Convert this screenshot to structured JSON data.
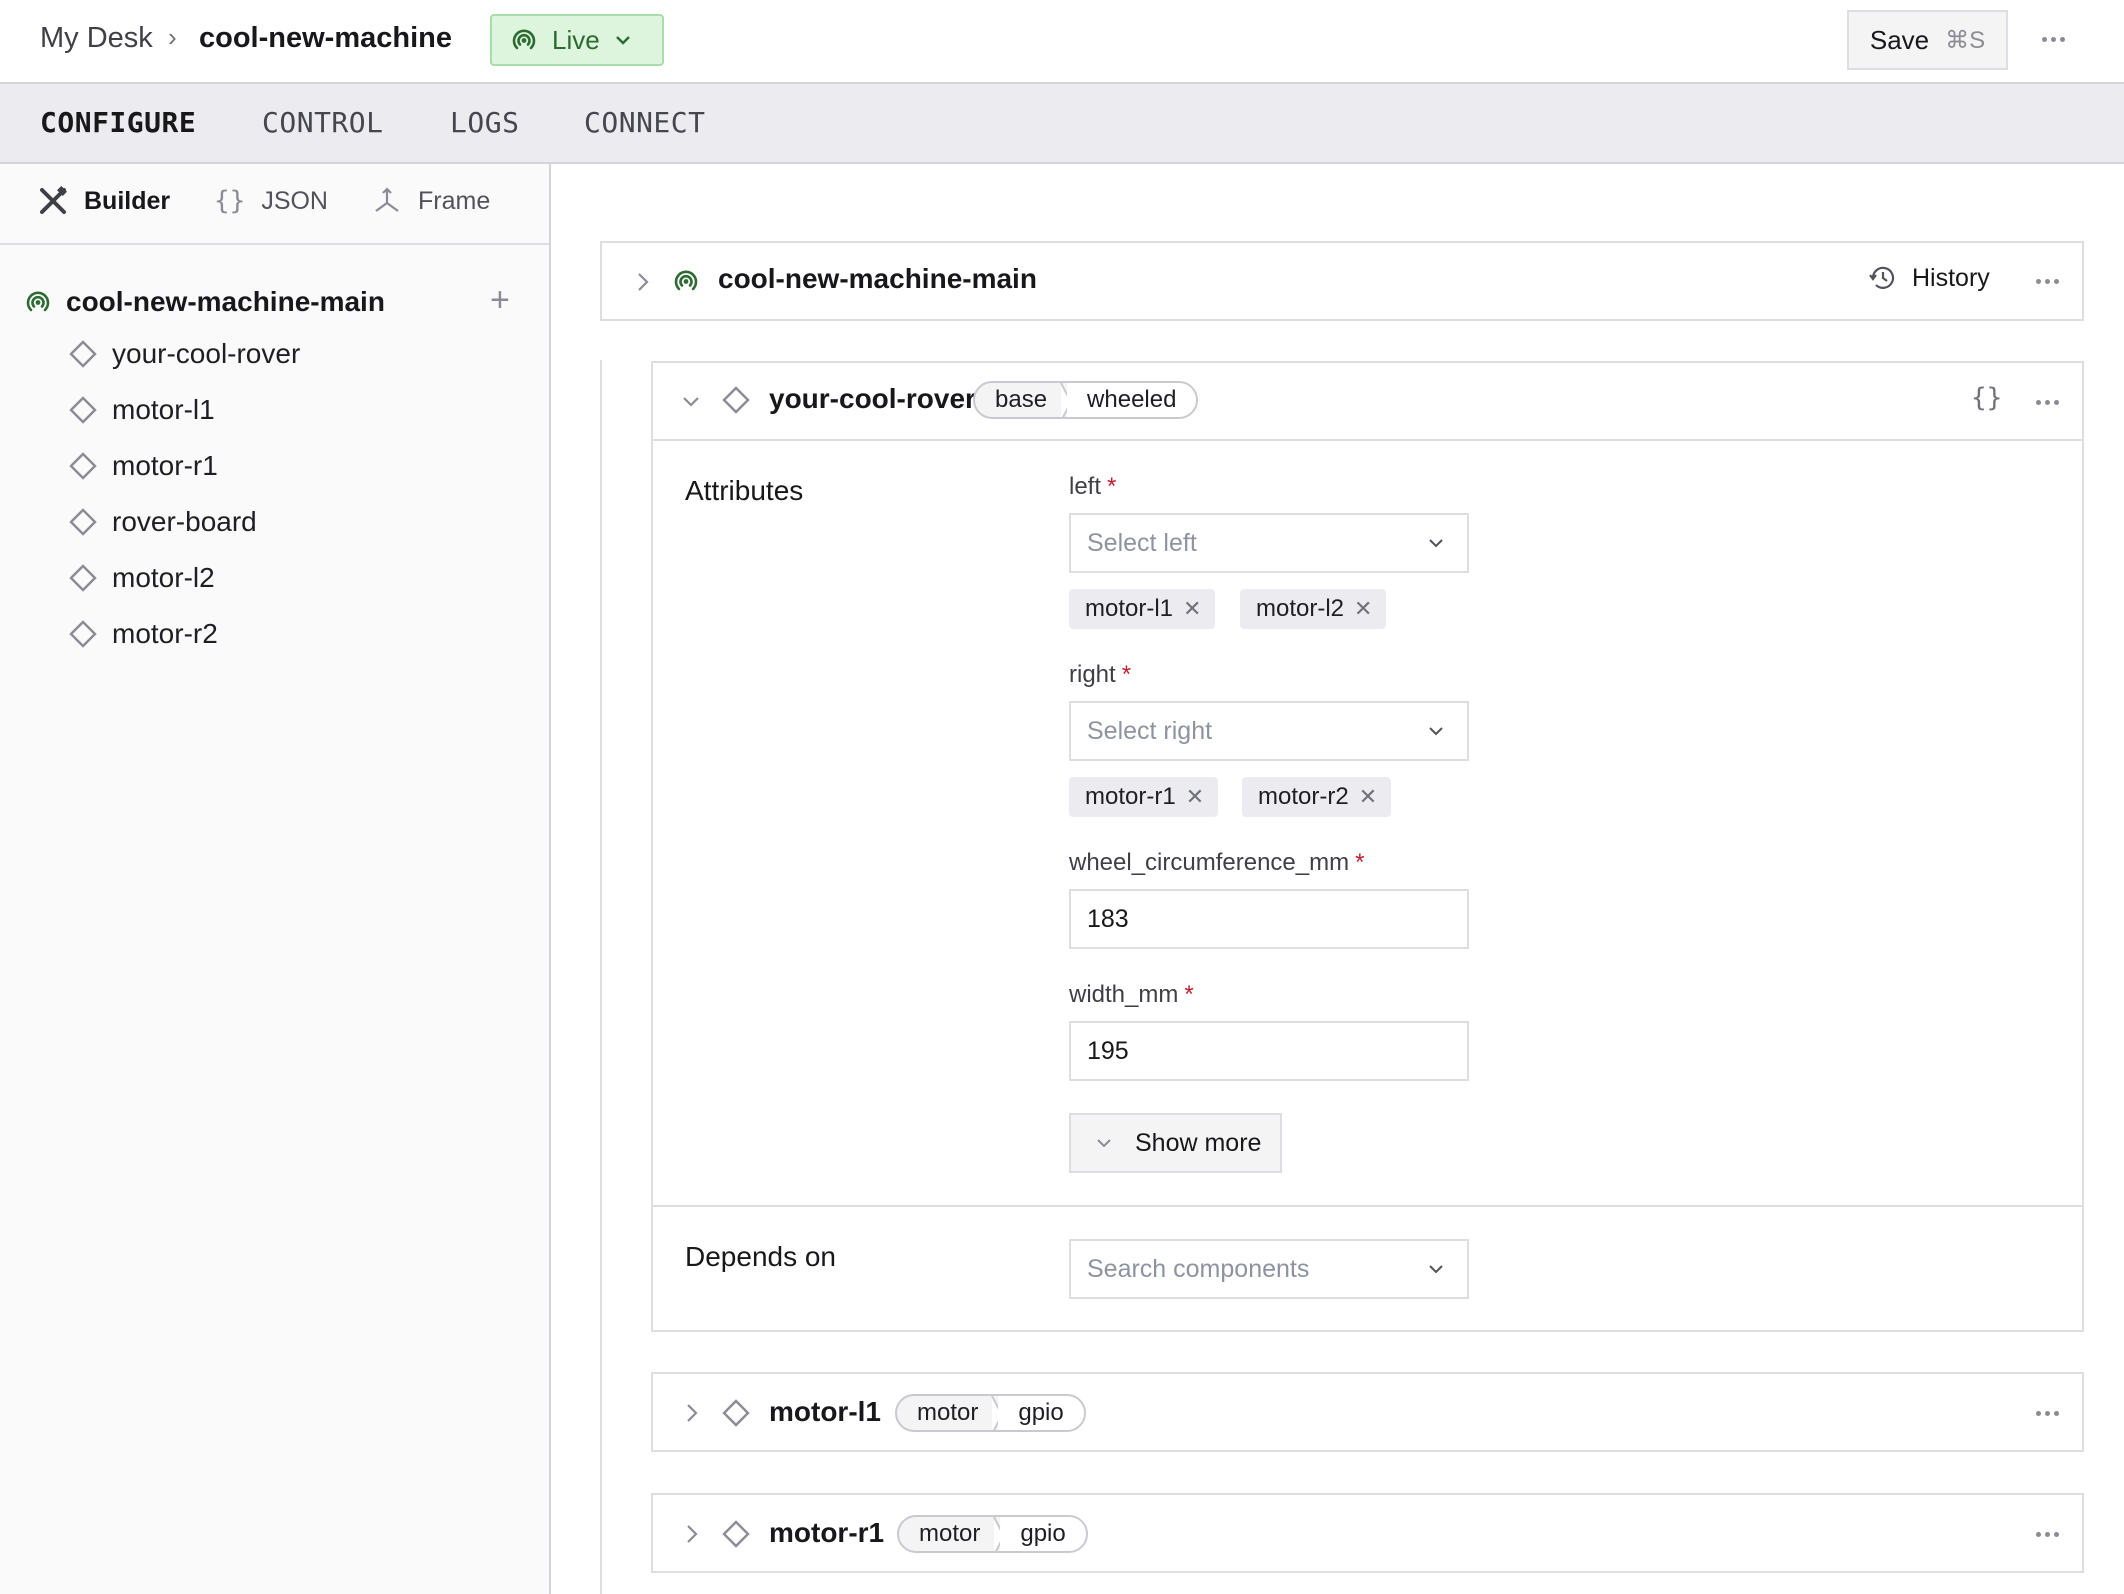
{
  "header": {
    "breadcrumb_root": "My Desk",
    "breadcrumb_separator": "›",
    "breadcrumb_current": "cool-new-machine",
    "status_label": "Live",
    "save_label": "Save",
    "save_shortcut": "⌘S"
  },
  "tabs": [
    {
      "label": "CONFIGURE",
      "active": true
    },
    {
      "label": "CONTROL",
      "active": false
    },
    {
      "label": "LOGS",
      "active": false
    },
    {
      "label": "CONNECT",
      "active": false
    }
  ],
  "sidebar": {
    "subtabs": [
      {
        "label": "Builder",
        "icon": "tools-icon",
        "active": true
      },
      {
        "label": "JSON",
        "icon": "braces-icon",
        "active": false
      },
      {
        "label": "Frame",
        "icon": "axes-icon",
        "active": false
      }
    ],
    "root": "cool-new-machine-main",
    "items": [
      "your-cool-rover",
      "motor-l1",
      "motor-r1",
      "rover-board",
      "motor-l2",
      "motor-r2"
    ]
  },
  "main": {
    "part_card": {
      "title": "cool-new-machine-main",
      "history_label": "History"
    },
    "rover_card": {
      "title": "your-cool-rover",
      "type": "base",
      "model": "wheeled",
      "attributes_label": "Attributes",
      "fields": {
        "left": {
          "label": "left",
          "placeholder": "Select left",
          "chips": [
            "motor-l1",
            "motor-l2"
          ]
        },
        "right": {
          "label": "right",
          "placeholder": "Select right",
          "chips": [
            "motor-r1",
            "motor-r2"
          ]
        },
        "wheel_circumference_mm": {
          "label": "wheel_circumference_mm",
          "value": "183"
        },
        "width_mm": {
          "label": "width_mm",
          "value": "195"
        }
      },
      "required_marker": "*",
      "show_more_label": "Show more",
      "depends_on_label": "Depends on",
      "depends_on_placeholder": "Search components"
    },
    "collapsed_cards": [
      {
        "title": "motor-l1",
        "type": "motor",
        "model": "gpio"
      },
      {
        "title": "motor-r1",
        "type": "motor",
        "model": "gpio"
      }
    ]
  },
  "colors": {
    "live_green": "#2d6b32",
    "live_bg": "#dcf5dc",
    "required_red": "#be1e2d",
    "tabbar_bg": "#ecebf0"
  }
}
